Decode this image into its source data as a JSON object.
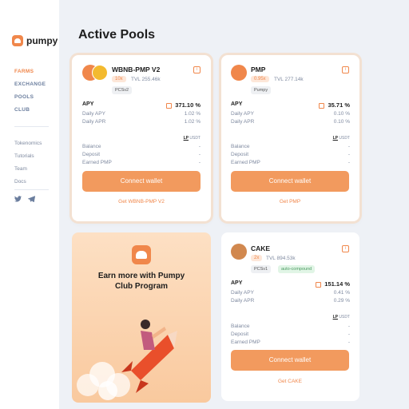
{
  "brand": "pumpy",
  "nav": [
    "FARMS",
    "EXCHANGE",
    "POOLS",
    "CLUB"
  ],
  "links": [
    "Tokenomics",
    "Tutorials",
    "Team",
    "Docs"
  ],
  "page_title": "Active Pools",
  "labels": {
    "apy": "APY",
    "daily_apy": "Daily APY",
    "daily_apr": "Daily APR",
    "lp": "LP",
    "usdt": "USDT",
    "balance": "Balance",
    "deposit": "Deposit",
    "earned": "Earned PMP",
    "connect": "Connect wallet"
  },
  "pools": [
    {
      "name": "WBNB-PMP V2",
      "mult": "10x",
      "tvl": "TVL 255.46k",
      "tags": [
        "PCSv2"
      ],
      "apy": "371.10 %",
      "daily_apy": "1.02 %",
      "daily_apr": "1.02 %",
      "balance": "-",
      "deposit": "-",
      "earned": "-",
      "get": "Get WBNB-PMP V2"
    },
    {
      "name": "PMP",
      "mult": "0.95x",
      "tvl": "TVL 277.14k",
      "tags": [
        "Pumpy"
      ],
      "apy": "35.71 %",
      "daily_apy": "0.10 %",
      "daily_apr": "0.10 %",
      "balance": "-",
      "deposit": "-",
      "earned": "-",
      "get": "Get PMP"
    },
    {
      "name": "CAKE",
      "mult": "2x",
      "tvl": "TVL 894.53k",
      "tags": [
        "PCSv1",
        "auto-compound"
      ],
      "apy": "151.14 %",
      "daily_apy": "0.41 %",
      "daily_apr": "0.29 %",
      "balance": "-",
      "deposit": "-",
      "earned": "-",
      "get": "Get CAKE"
    }
  ],
  "promo": {
    "line1": "Earn more with Pumpy",
    "line2": "Club Program"
  },
  "colors": {
    "accent": "#f0874b",
    "button": "#f29a5e",
    "bnb": "#f3ba2f",
    "cake": "#d1884f"
  }
}
